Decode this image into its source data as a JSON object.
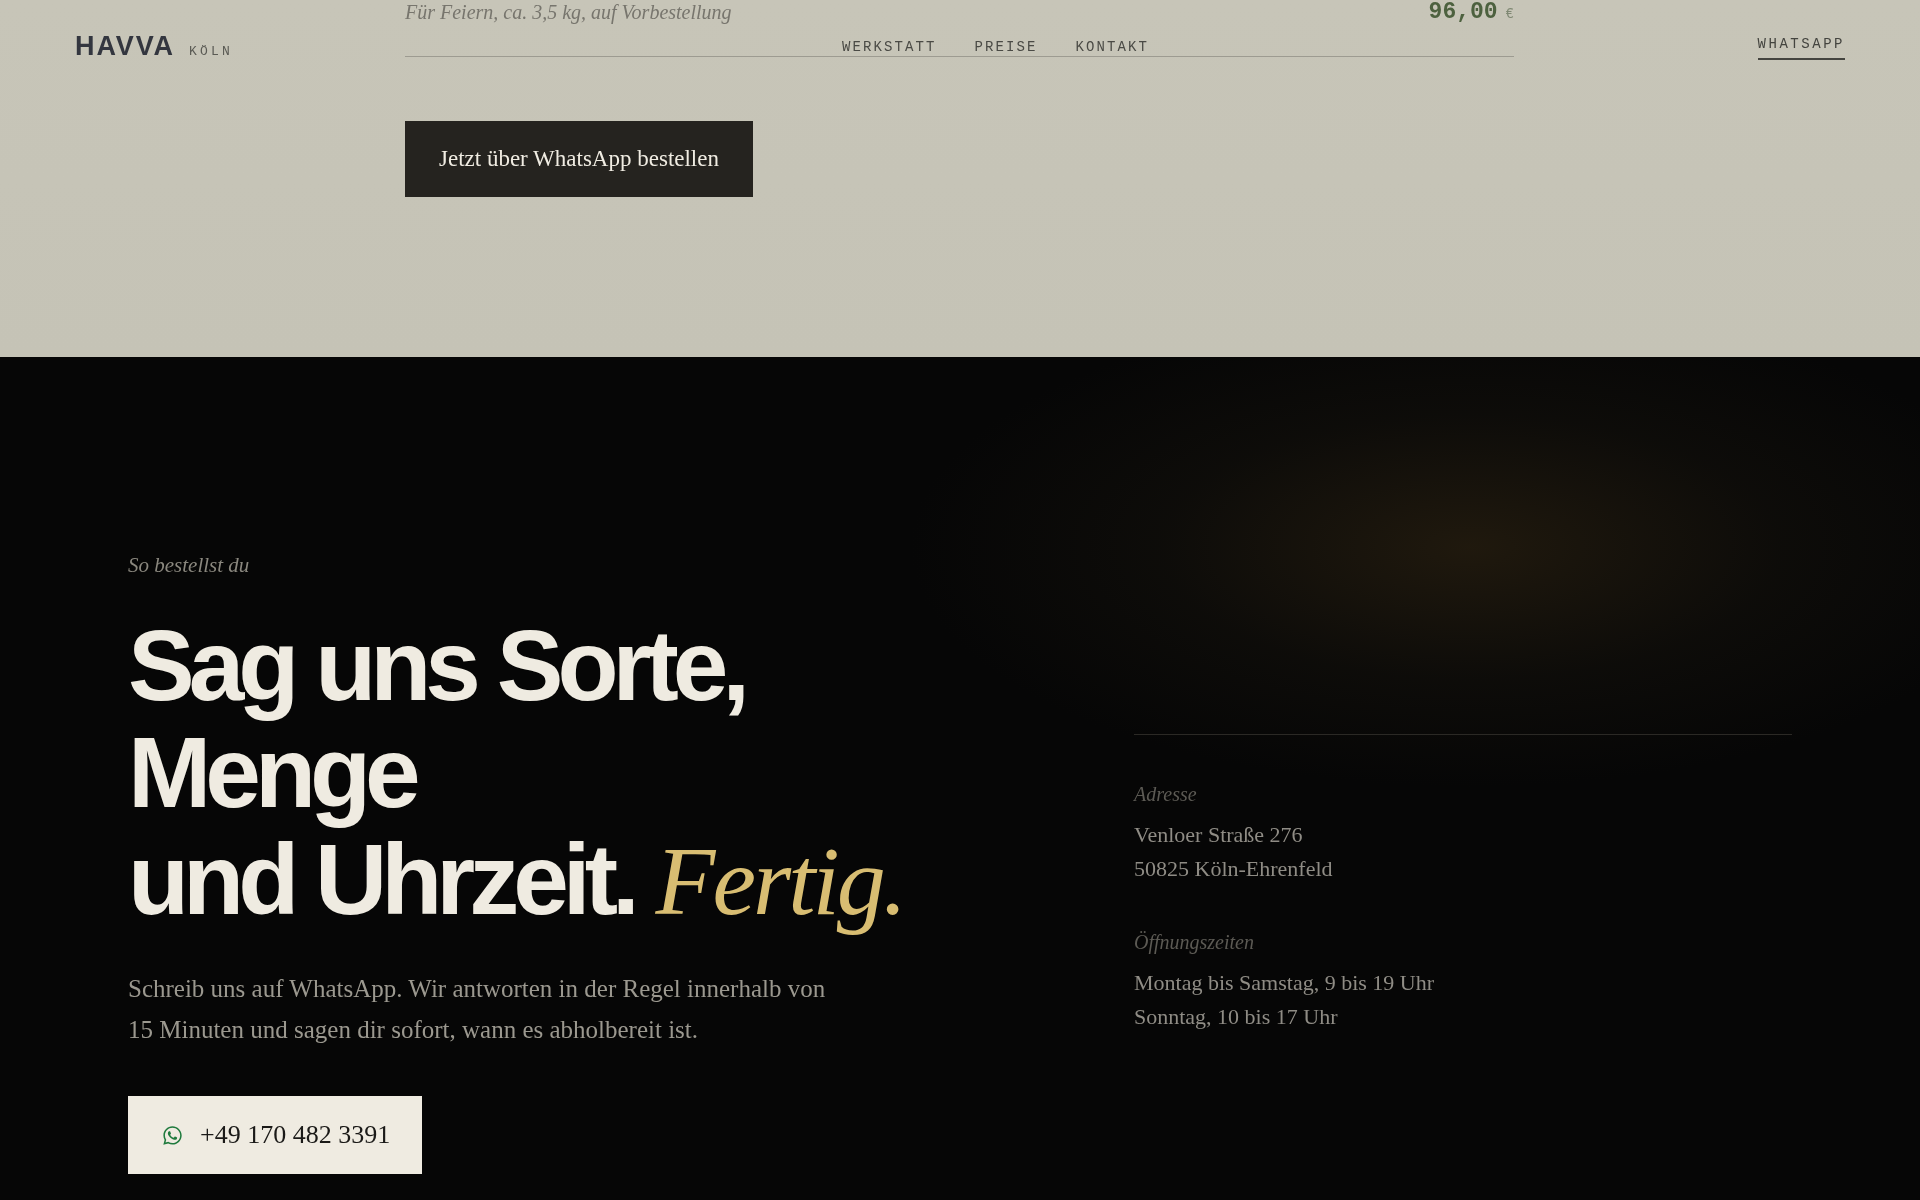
{
  "header": {
    "brand": "HAVVA",
    "city": "KÖLN",
    "nav": [
      {
        "label": "WERKSTATT"
      },
      {
        "label": "PREISE"
      },
      {
        "label": "KONTAKT"
      }
    ],
    "cta": "WHATSAPP"
  },
  "product": {
    "description": "Für Feiern, ca. 3,5 kg, auf Vorbestellung",
    "price": "96,00",
    "currency": "€",
    "button": "Jetzt über WhatsApp bestellen"
  },
  "order": {
    "eyebrow": "So bestellst du",
    "heading_lines": [
      "Sag uns Sorte,",
      "Menge",
      "und Uhrzeit."
    ],
    "heading_accent": "Fertig.",
    "text": "Schreib uns auf WhatsApp. Wir antworten in der Regel innerhalb von 15 Minuten und sagen dir sofort, wann es abholbereit ist.",
    "phone_button": "+49 170 482 3391"
  },
  "info": [
    {
      "label": "Adresse",
      "lines": [
        "Venloer Straße 276",
        "50825 Köln-Ehrenfeld"
      ]
    },
    {
      "label": "Öffnungszeiten",
      "lines": [
        "Montag bis Samstag, 9 bis 19 Uhr",
        "Sonntag, 10 bis 17 Uhr"
      ]
    }
  ]
}
